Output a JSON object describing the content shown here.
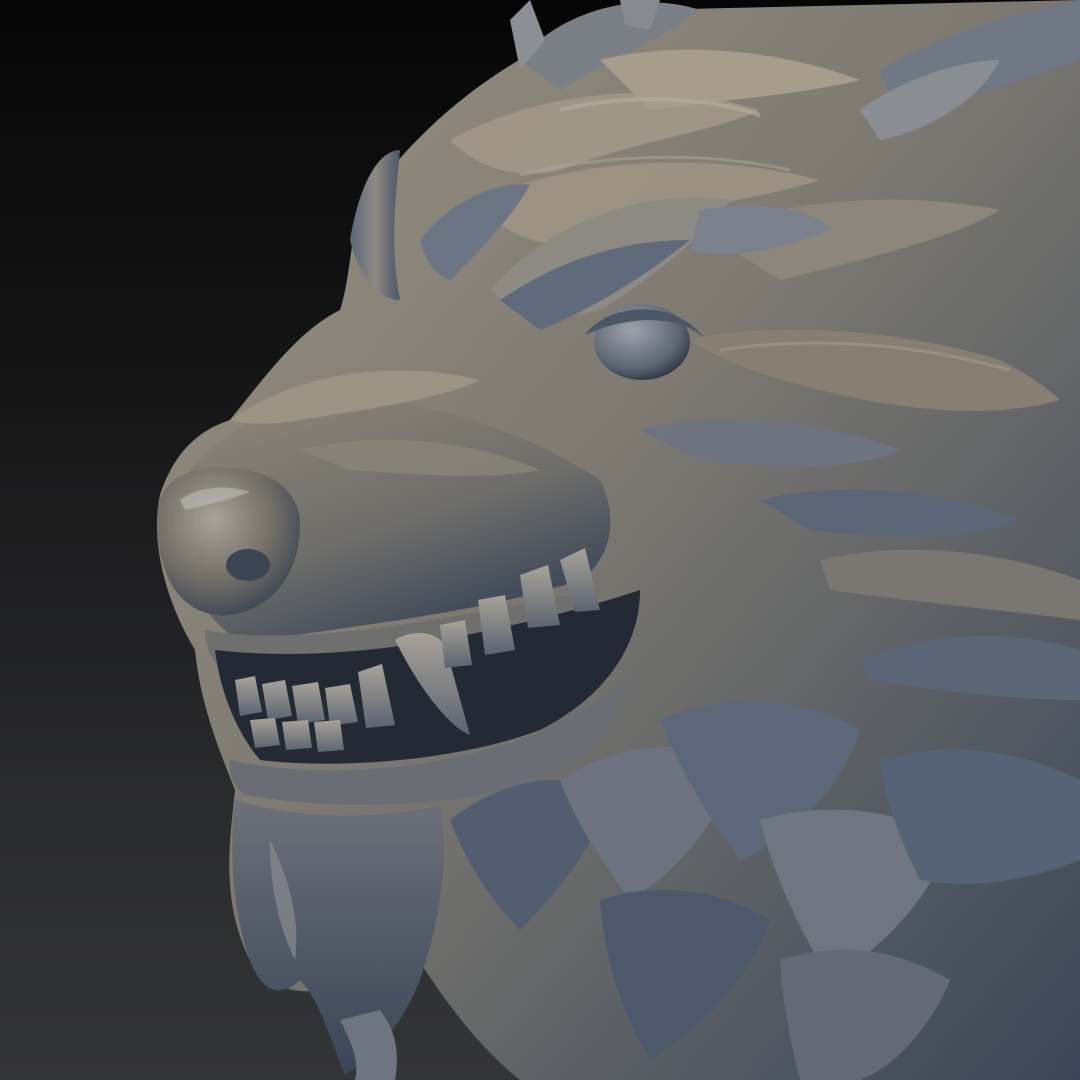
{
  "scene": {
    "subject": "werewolf-head-sculpt",
    "material_colors": {
      "base": "#8a8478",
      "warm": "#9b8f7c",
      "cool_shadow": "#3d4a5c",
      "deep_shadow": "#1f2733",
      "highlight": "#c9cdd2"
    },
    "background_colors": {
      "top": "#060606",
      "bottom": "#343537"
    }
  }
}
